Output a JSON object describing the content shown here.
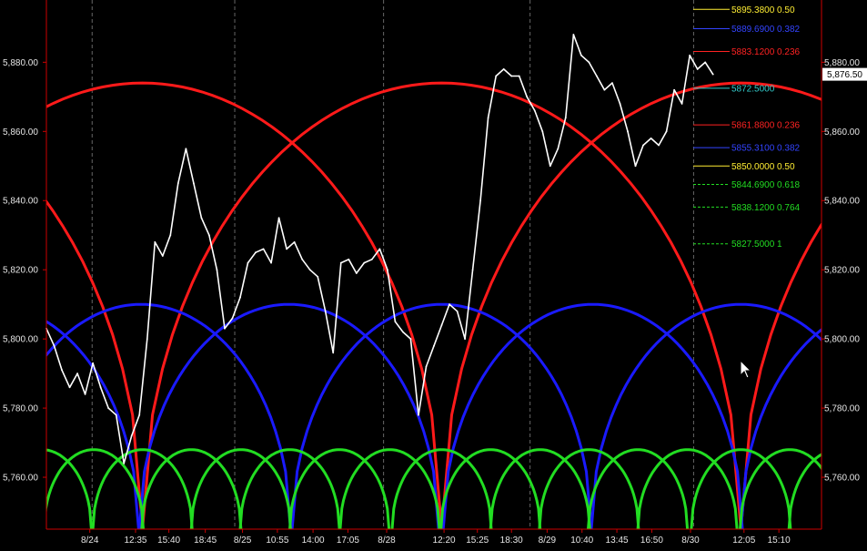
{
  "chart_data": {
    "type": "line",
    "ylim": [
      5745,
      5898
    ],
    "xlim": [
      0,
      100
    ],
    "grid": false,
    "colors": {
      "background": "#000000",
      "price": "#ffffff",
      "axis": "#cc0000",
      "arc_large": "#ff1a1a",
      "arc_medium": "#1a1aff",
      "arc_small": "#22dd22",
      "divider": "#666666"
    },
    "y_ticks": [
      {
        "value": 5880,
        "label": "5,880.00"
      },
      {
        "value": 5860,
        "label": "5,860.00"
      },
      {
        "value": 5840,
        "label": "5,840.00"
      },
      {
        "value": 5820,
        "label": "5,820.00"
      },
      {
        "value": 5800,
        "label": "5,800.00"
      },
      {
        "value": 5780,
        "label": "5,780.00"
      },
      {
        "value": 5760,
        "label": "5,760.00"
      }
    ],
    "x_ticks": [
      {
        "x": 5.6,
        "label": "8/24"
      },
      {
        "x": 11.5,
        "label": "12:35"
      },
      {
        "x": 15.8,
        "label": "15:40"
      },
      {
        "x": 20.5,
        "label": "18:45"
      },
      {
        "x": 25.3,
        "label": "8/25"
      },
      {
        "x": 29.8,
        "label": "10:55"
      },
      {
        "x": 34.4,
        "label": "14:00"
      },
      {
        "x": 38.9,
        "label": "17:05"
      },
      {
        "x": 43.9,
        "label": "8/28"
      },
      {
        "x": 51.3,
        "label": "12:20"
      },
      {
        "x": 55.6,
        "label": "15:25"
      },
      {
        "x": 60.0,
        "label": "18:30"
      },
      {
        "x": 64.6,
        "label": "8/29"
      },
      {
        "x": 69.1,
        "label": "10:40"
      },
      {
        "x": 73.6,
        "label": "13:45"
      },
      {
        "x": 78.1,
        "label": "16:50"
      },
      {
        "x": 83.1,
        "label": "8/30"
      },
      {
        "x": 90.0,
        "label": "12:05"
      },
      {
        "x": 94.5,
        "label": "15:10"
      }
    ],
    "day_dividers": [
      5.9,
      24.3,
      43.5,
      62.4,
      83.5
    ],
    "last_price": {
      "value": 5876.5,
      "label": "5,876.50"
    },
    "fib_levels": [
      {
        "value": 5895.3,
        "label": "5895.3800 0.50",
        "color": "#ffee33",
        "dashed": false
      },
      {
        "value": 5889.69,
        "label": "5889.6900 0.382",
        "color": "#3344ff",
        "dashed": false
      },
      {
        "value": 5883.12,
        "label": "5883.1200 0.236",
        "color": "#ff2222",
        "dashed": false
      },
      {
        "value": 5872.5,
        "label": "5872.5000",
        "color": "#33cccc",
        "dashed": false
      },
      {
        "value": 5861.88,
        "label": "5861.8800 0.236",
        "color": "#ff2222",
        "dashed": false
      },
      {
        "value": 5855.31,
        "label": "5855.3100 0.382",
        "color": "#3344ff",
        "dashed": false
      },
      {
        "value": 5850.0,
        "label": "5850.0000 0.50",
        "color": "#ffee33",
        "dashed": false
      },
      {
        "value": 5844.69,
        "label": "5844.6900 0.618",
        "color": "#22dd22",
        "dashed": true
      },
      {
        "value": 5838.12,
        "label": "5838.1200 0.764",
        "color": "#22dd22",
        "dashed": true
      },
      {
        "value": 5827.5,
        "label": "5827.5000 1",
        "color": "#22dd22",
        "dashed": true
      }
    ],
    "arcs": [
      {
        "name": "large",
        "color": "#ff1a1a",
        "centers": [
          -26.2,
          12.4,
          51.0,
          89.6,
          128.2
        ],
        "half_width": 38.6,
        "base": 5745,
        "peak": 5874
      },
      {
        "name": "medium",
        "color": "#1a1aff",
        "centers": [
          -7.4,
          12.2,
          31.3,
          51.0,
          70.5,
          89.6,
          108.9
        ],
        "half_width": 19.3,
        "base": 5745,
        "peak": 5810
      },
      {
        "name": "small",
        "color": "#22dd22",
        "centers": [
          -0.6,
          6.1,
          12.4,
          18.7,
          25.1,
          31.4,
          37.8,
          44.3,
          51.0,
          57.3,
          63.7,
          70.0,
          76.3,
          82.7,
          89.6,
          95.9,
          102.2
        ],
        "half_width": 6.4,
        "base": 5745,
        "peak": 5768
      }
    ],
    "series": [
      {
        "x": [
          0,
          1,
          2,
          3,
          4,
          5,
          6,
          7,
          8,
          9,
          10,
          11,
          12,
          13,
          14,
          15,
          16,
          17,
          18,
          19,
          20,
          21,
          22,
          23,
          24,
          25,
          26,
          27,
          28,
          29,
          30,
          31,
          32,
          33,
          34,
          35,
          36,
          37,
          38,
          39,
          40,
          41,
          42,
          43,
          44,
          45,
          46,
          47,
          48,
          49,
          50,
          51,
          52,
          53,
          54,
          55,
          56,
          57,
          58,
          59,
          60,
          61,
          62,
          63,
          64,
          65,
          66,
          67,
          68,
          69,
          70,
          71,
          72,
          73,
          74,
          75,
          76,
          77,
          78,
          79,
          80,
          81,
          82,
          83,
          84,
          85,
          86
        ],
        "values": [
          5803,
          5798,
          5791,
          5786,
          5790,
          5784,
          5793,
          5786,
          5780,
          5778,
          5764,
          5772,
          5778,
          5800,
          5828,
          5824,
          5830,
          5845,
          5855,
          5845,
          5835,
          5830,
          5820,
          5803,
          5806,
          5812,
          5822,
          5825,
          5826,
          5822,
          5835,
          5826,
          5828,
          5823,
          5820,
          5818,
          5808,
          5796,
          5822,
          5823,
          5819,
          5822,
          5823,
          5826,
          5820,
          5805,
          5802,
          5800,
          5778,
          5792,
          5798,
          5804,
          5810,
          5808,
          5800,
          5820,
          5840,
          5864,
          5876,
          5878,
          5876,
          5876,
          5870,
          5866,
          5860,
          5850,
          5855,
          5864,
          5888,
          5882,
          5880,
          5876,
          5872,
          5874,
          5868,
          5860,
          5850,
          5856,
          5858,
          5856,
          5860,
          5872,
          5868,
          5882,
          5878,
          5880,
          5876.5
        ]
      }
    ]
  }
}
